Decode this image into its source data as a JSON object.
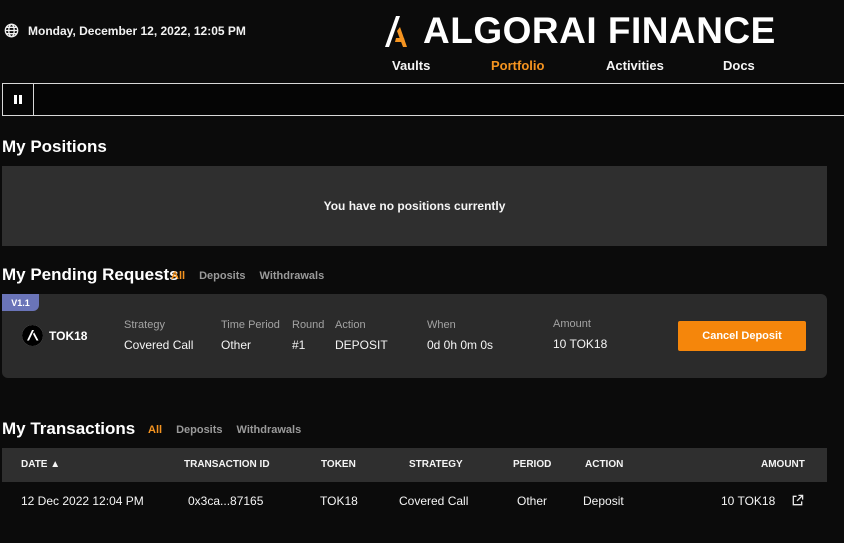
{
  "header": {
    "datetime": "Monday, December 12, 2022, 12:05 PM",
    "brand": "ALGORAI FINANCE",
    "nav": [
      "Vaults",
      "Portfolio",
      "Activities",
      "Docs"
    ],
    "active_nav": "Portfolio"
  },
  "positions": {
    "title": "My Positions",
    "empty_message": "You have no positions currently"
  },
  "pending": {
    "title": "My Pending Requests",
    "filters": [
      "All",
      "Deposits",
      "Withdrawals"
    ],
    "active_filter": "All",
    "request": {
      "version": "V1.1",
      "token": "TOK18",
      "fields": [
        {
          "label": "Strategy",
          "value": "Covered Call"
        },
        {
          "label": "Time Period",
          "value": "Other"
        },
        {
          "label": "Round",
          "value": "#1"
        },
        {
          "label": "Action",
          "value": "DEPOSIT"
        },
        {
          "label": "When",
          "value": "0d 0h 0m 0s"
        },
        {
          "label": "Amount",
          "value": "10 TOK18"
        }
      ],
      "button": "Cancel Deposit"
    }
  },
  "transactions": {
    "title": "My Transactions",
    "filters": [
      "All",
      "Deposits",
      "Withdrawals"
    ],
    "active_filter": "All",
    "columns": [
      "DATE ▲",
      "TRANSACTION ID",
      "TOKEN",
      "STRATEGY",
      "PERIOD",
      "ACTION",
      "AMOUNT"
    ],
    "rows": [
      [
        "12 Dec 2022 12:04 PM",
        "0x3ca...87165",
        "TOK18",
        "Covered Call",
        "Other",
        "Deposit",
        "10 TOK18"
      ]
    ]
  },
  "colors": {
    "accent": "#f59420",
    "button": "#f5860b",
    "badge": "#6a74b8",
    "card": "#2b2b2b"
  }
}
